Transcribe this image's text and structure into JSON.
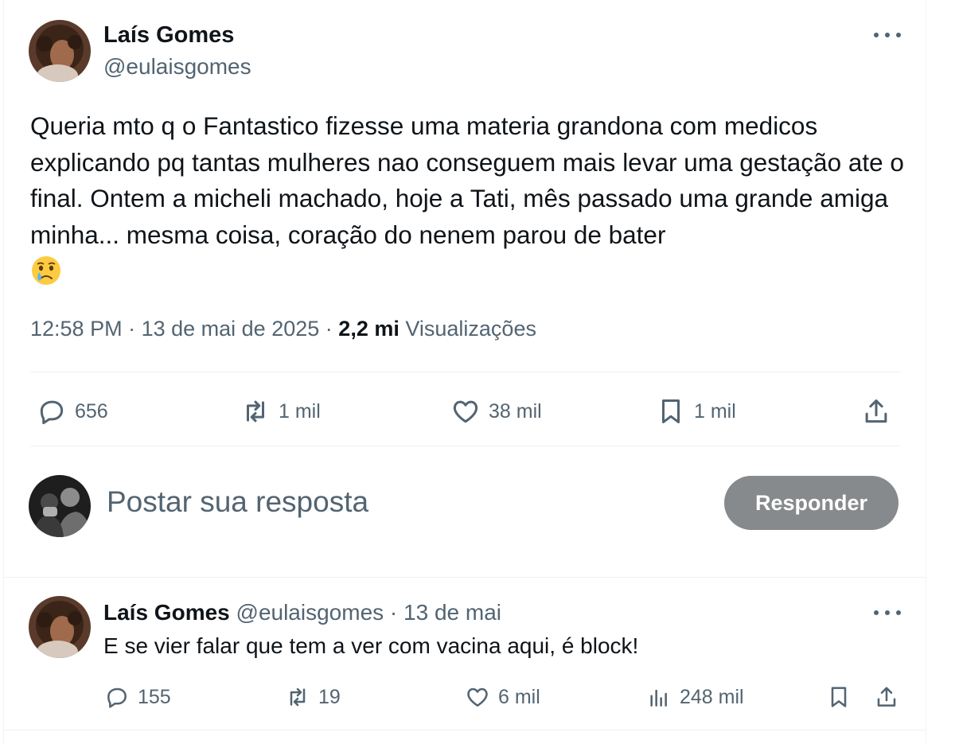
{
  "tweet": {
    "author_name": "Laís Gomes",
    "author_handle": "@eulaisgomes",
    "text": "Queria mto q o Fantastico fizesse uma materia grandona com medicos explicando pq tantas mulheres nao conseguem mais levar uma gestação ate o final. Ontem a micheli machado, hoje a Tati, mês passado uma grande amiga minha... mesma coisa, coração do nenem parou de bater",
    "emoji": "crying-face",
    "time": "12:58 PM",
    "date": "13 de mai de 2025",
    "views_count": "2,2 mi",
    "views_label": "Visualizações",
    "actions": {
      "replies": "656",
      "retweets": "1 mil",
      "likes": "38 mil",
      "bookmarks": "1 mil"
    }
  },
  "composer": {
    "placeholder": "Postar sua resposta",
    "button_label": "Responder"
  },
  "reply": {
    "author_name": "Laís Gomes",
    "author_handle": "@eulaisgomes",
    "date": "13 de mai",
    "text": "E se vier falar que tem a ver com vacina aqui, é block!",
    "actions": {
      "replies": "155",
      "retweets": "19",
      "likes": "6 mil",
      "views": "248 mil"
    }
  },
  "colors": {
    "text": "#0f1419",
    "secondary": "#536471",
    "divider": "#eff3f4",
    "button_disabled": "#878a8c"
  }
}
